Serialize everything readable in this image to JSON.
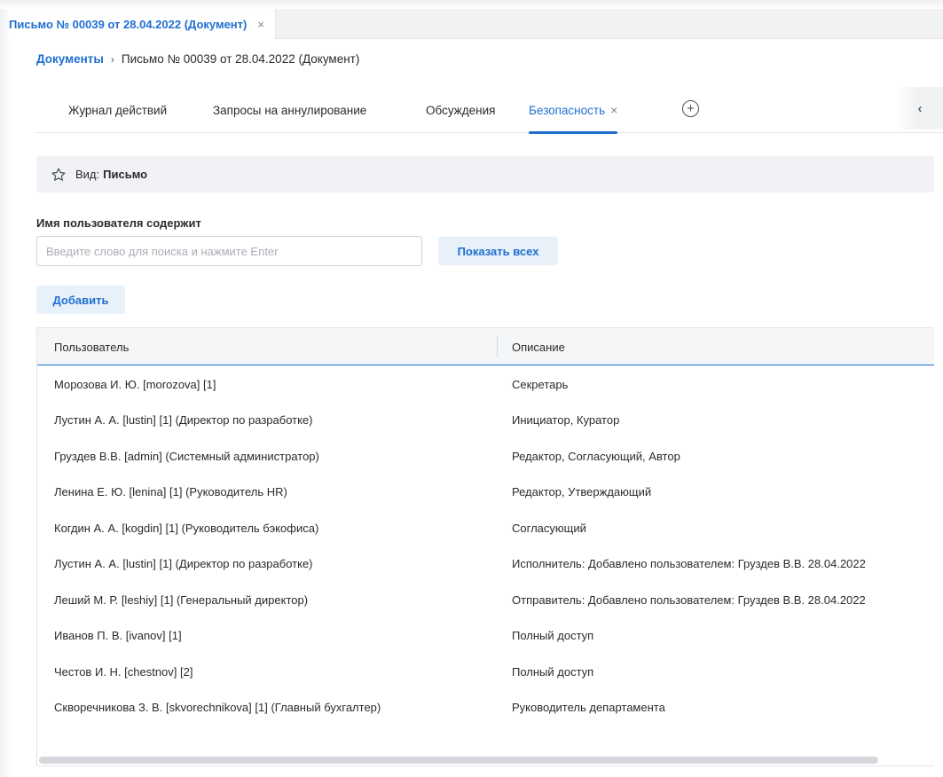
{
  "window_tab": {
    "title": "Письмо № 00039 от 28.04.2022 (Документ)",
    "close_glyph": "×"
  },
  "breadcrumb": {
    "root": "Документы",
    "separator": "›",
    "current": "Письмо № 00039 от 28.04.2022 (Документ)"
  },
  "tabs": [
    {
      "label": "Журнал действий",
      "active": false
    },
    {
      "label": "Запросы на аннулирование",
      "active": false
    },
    {
      "label": "Обсуждения",
      "active": false
    },
    {
      "label": "Безопасность",
      "active": true
    }
  ],
  "tab_close_glyph": "×",
  "tab_add_glyph": "+",
  "tabs_scroll_glyph": "‹",
  "kind": {
    "label": "Вид:",
    "value": "Письмо",
    "icon": "star-outline-icon"
  },
  "search": {
    "label": "Имя пользователя содержит",
    "placeholder": "Введите слово для поиска и нажмите Enter",
    "value": ""
  },
  "buttons": {
    "show_all": "Показать всех",
    "add": "Добавить"
  },
  "table": {
    "columns": [
      "Пользователь",
      "Описание"
    ],
    "rows": [
      [
        "Морозова И. Ю. [morozova] [1]",
        "Секретарь"
      ],
      [
        "Лустин А. А. [lustin] [1] (Директор по разработке)",
        "Инициатор, Куратор"
      ],
      [
        "Груздев В.В. [admin] (Системный администратор)",
        "Редактор, Согласующий, Автор"
      ],
      [
        "Ленина Е. Ю. [lenina] [1] (Руководитель HR)",
        "Редактор, Утверждающий"
      ],
      [
        "Когдин А. А. [kogdin] [1] (Руководитель бэкофиса)",
        "Согласующий"
      ],
      [
        "Лустин А. А. [lustin] [1] (Директор по разработке)",
        "Исполнитель: Добавлено пользователем: Груздев В.В. 28.04.2022"
      ],
      [
        "Леший М. Р. [leshiy] [1] (Генеральный директор)",
        "Отправитель: Добавлено пользователем: Груздев В.В. 28.04.2022"
      ],
      [
        "Иванов П. В. [ivanov] [1]",
        "Полный доступ"
      ],
      [
        "Честов И. Н. [chestnov] [2]",
        "Полный доступ"
      ],
      [
        "Скворечникова З. В. [skvorechnikova] [1] (Главный бухгалтер)",
        "Руководитель департамента"
      ]
    ]
  },
  "colors": {
    "accent": "#1f6fd1",
    "button_bg": "#e8f0fa",
    "panel_bg": "#f0f2f5"
  }
}
